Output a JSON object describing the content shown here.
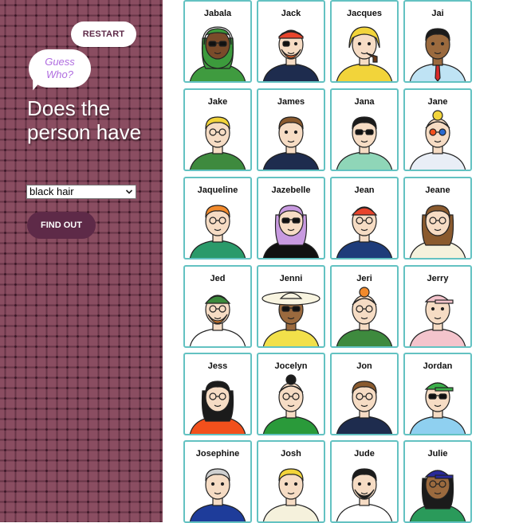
{
  "sidebar": {
    "restart_label": "RESTART",
    "bubble_line1": "Guess",
    "bubble_line2": "Who?",
    "question": "Does the person have",
    "select_value": "black hair",
    "find_label": "FIND OUT",
    "background_color": "#8a4d61",
    "button_color": "#5e2a48"
  },
  "board": {
    "border_color": "#63c2c2",
    "cards": [
      {
        "name": "Jabala",
        "hair": "#3c9a3c",
        "skin": "#7a4b2a",
        "shirt": "#3f9b3f",
        "acc": "sunglasses",
        "hat": "hijab"
      },
      {
        "name": "Jack",
        "hair": "#e8642c",
        "skin": "#f6dcc4",
        "shirt": "#1e2c4e",
        "acc": "eyepatch",
        "hat": "bandana"
      },
      {
        "name": "Jacques",
        "hair": "#f2d43a",
        "skin": "#f6dcc4",
        "shirt": "#f2d43a",
        "acc": "pipe",
        "hat": "raincoat"
      },
      {
        "name": "Jai",
        "hair": "#1b1b1b",
        "skin": "#9b6a3e",
        "shirt": "#bfe3f4",
        "acc": "tie",
        "hat": "none"
      },
      {
        "name": "Jake",
        "hair": "#f2d43a",
        "skin": "#f6dcc4",
        "shirt": "#3e8a3e",
        "acc": "glasses",
        "hat": "none"
      },
      {
        "name": "James",
        "hair": "#8a5a2e",
        "skin": "#f6dcc4",
        "shirt": "#1e2c4e",
        "acc": "none",
        "hat": "none"
      },
      {
        "name": "Jana",
        "hair": "#1b1b1b",
        "skin": "#f6dcc4",
        "shirt": "#8fd6b8",
        "acc": "sunglasses",
        "hat": "none"
      },
      {
        "name": "Jane",
        "hair": "#f2d43a",
        "skin": "#f6dcc4",
        "shirt": "#e9eef6",
        "acc": "glasses-color",
        "hat": "bun"
      },
      {
        "name": "Jaqueline",
        "hair": "#f28a2c",
        "skin": "#f6dcc4",
        "shirt": "#2a9a6a",
        "acc": "glasses",
        "hat": "none"
      },
      {
        "name": "Jazebelle",
        "hair": "#c89ae0",
        "skin": "#f6dcc4",
        "shirt": "#111111",
        "acc": "sunglasses",
        "hat": "none"
      },
      {
        "name": "Jean",
        "hair": "#e8642c",
        "skin": "#f6dcc4",
        "shirt": "#1e3c7a",
        "acc": "glasses",
        "hat": "beanie"
      },
      {
        "name": "Jeane",
        "hair": "#8a5a2e",
        "skin": "#f6dcc4",
        "shirt": "#f5f1dc",
        "acc": "glasses",
        "hat": "none"
      },
      {
        "name": "Jed",
        "hair": "#e8842c",
        "skin": "#f6dcc4",
        "shirt": "#ffffff",
        "acc": "glasses",
        "hat": "beanie-green"
      },
      {
        "name": "Jenni",
        "hair": "#8a5a2e",
        "skin": "#9b6a3e",
        "shirt": "#f2e04a",
        "acc": "sunglasses",
        "hat": "sunhat"
      },
      {
        "name": "Jeri",
        "hair": "#f28a2c",
        "skin": "#f6dcc4",
        "shirt": "#3e8a3e",
        "acc": "glasses",
        "hat": "bun"
      },
      {
        "name": "Jerry",
        "hair": "#e9a0a8",
        "skin": "#f6dcc4",
        "shirt": "#f4c4cc",
        "acc": "none",
        "hat": "cap"
      },
      {
        "name": "Jess",
        "hair": "#1b1b1b",
        "skin": "#f6dcc4",
        "shirt": "#f2501c",
        "acc": "glasses",
        "hat": "none"
      },
      {
        "name": "Jocelyn",
        "hair": "#1b1b1b",
        "skin": "#f6dcc4",
        "shirt": "#2a9a3a",
        "acc": "glasses",
        "hat": "bun"
      },
      {
        "name": "Jon",
        "hair": "#8a5a2e",
        "skin": "#f6dcc4",
        "shirt": "#1e2c4e",
        "acc": "glasses",
        "hat": "none"
      },
      {
        "name": "Jordan",
        "hair": "#f2d43a",
        "skin": "#f6dcc4",
        "shirt": "#8fd0f0",
        "acc": "sunglasses",
        "hat": "cap-green"
      },
      {
        "name": "Josephine",
        "hair": "#cfcfcf",
        "skin": "#f6dcc4",
        "shirt": "#1e3c9a",
        "acc": "none",
        "hat": "none"
      },
      {
        "name": "Josh",
        "hair": "#f2d43a",
        "skin": "#f6dcc4",
        "shirt": "#f5f1dc",
        "acc": "none",
        "hat": "none"
      },
      {
        "name": "Jude",
        "hair": "#1b1b1b",
        "skin": "#f6dcc4",
        "shirt": "#ffffff",
        "acc": "beard",
        "hat": "none"
      },
      {
        "name": "Julie",
        "hair": "#1b1b1b",
        "skin": "#9b6a3e",
        "shirt": "#2a9a5a",
        "acc": "glasses",
        "hat": "cap-blue"
      }
    ]
  }
}
